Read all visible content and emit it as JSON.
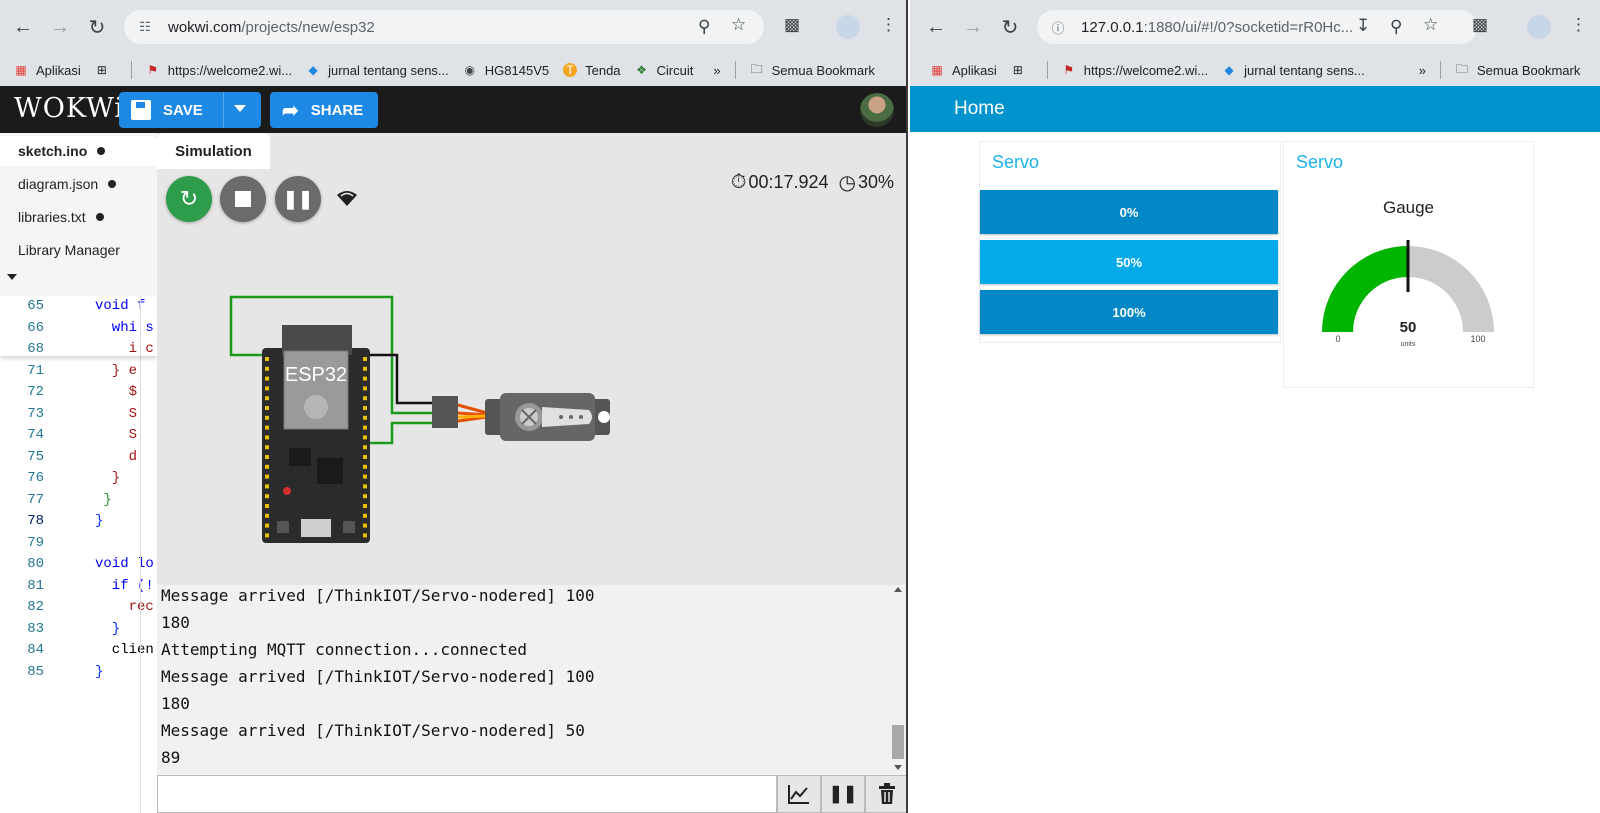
{
  "left_browser": {
    "omnibox": {
      "host": "wokwi.com",
      "path": "/projects/new/esp32"
    },
    "bookmarks": [
      {
        "label": "Aplikasi",
        "icon": "apps-grid-icon"
      },
      {
        "label": "https://welcome2.wi...",
        "icon": "bookmark-page-icon"
      },
      {
        "label": "jurnal tentang sens...",
        "icon": "diamond-icon"
      },
      {
        "label": "HG8145V5",
        "icon": "globe-icon"
      },
      {
        "label": "Tenda",
        "icon": "tenda-icon"
      },
      {
        "label": "Circuit",
        "icon": "circuit-icon"
      }
    ],
    "all_bookmarks": "Semua Bookmark",
    "more": "»"
  },
  "wokwi": {
    "logo": "WOKWi",
    "save_label": "SAVE",
    "share_label": "SHARE",
    "files": [
      {
        "name": "sketch.ino",
        "modified": true
      },
      {
        "name": "diagram.json",
        "modified": true
      },
      {
        "name": "libraries.txt",
        "modified": true
      },
      {
        "name": "Library Manager",
        "modified": false
      }
    ],
    "code_lines": [
      {
        "n": "65",
        "t": "void f"
      },
      {
        "n": "66",
        "t": "  whi s"
      },
      {
        "n": "68",
        "t": "    i c"
      },
      {
        "n": "71",
        "t": "  } e"
      },
      {
        "n": "72",
        "t": "    $"
      },
      {
        "n": "73",
        "t": "    S"
      },
      {
        "n": "74",
        "t": "    S"
      },
      {
        "n": "75",
        "t": "    d"
      },
      {
        "n": "76",
        "t": "  }"
      },
      {
        "n": "77",
        "t": " }"
      },
      {
        "n": "78",
        "t": "}"
      },
      {
        "n": "79",
        "t": ""
      },
      {
        "n": "80",
        "t": "void lo"
      },
      {
        "n": "81",
        "t": "  if (!"
      },
      {
        "n": "82",
        "t": "    rec"
      },
      {
        "n": "83",
        "t": "  }"
      },
      {
        "n": "84",
        "t": "  clien"
      },
      {
        "n": "85",
        "t": "}"
      }
    ],
    "simulation_tab": "Simulation",
    "timer": "00:17.924",
    "speed": "30%",
    "chip_label": "ESP32",
    "serial_lines": [
      "Message arrived [/ThinkIOT/Servo-nodered] 100",
      "180",
      "Attempting MQTT connection...connected",
      "Message arrived [/ThinkIOT/Servo-nodered] 100",
      "180",
      "Message arrived [/ThinkIOT/Servo-nodered] 50",
      "89"
    ]
  },
  "right_browser": {
    "omnibox": {
      "host": "127.0.0.1",
      "path": ":1880/ui/#!/0?socketid=rR0Hc..."
    },
    "bookmarks": [
      {
        "label": "Aplikasi",
        "icon": "apps-grid-icon"
      },
      {
        "label": "https://welcome2.wi...",
        "icon": "bookmark-page-icon"
      },
      {
        "label": "jurnal tentang sens...",
        "icon": "diamond-icon"
      }
    ],
    "all_bookmarks": "Semua Bookmark",
    "more": "»"
  },
  "dashboard": {
    "title": "Home",
    "group1_title": "Servo",
    "buttons": [
      {
        "label": "0%",
        "color": "#0288c7"
      },
      {
        "label": "50%",
        "color": "#03a9e8"
      },
      {
        "label": "100%",
        "color": "#0288c7"
      }
    ],
    "group2_title": "Servo",
    "gauge": {
      "title": "Gauge",
      "value": 50,
      "min": 0,
      "max": 100,
      "units": "units",
      "min_label": "0",
      "max_label": "100",
      "value_label": "50",
      "fill_color": "#00b500",
      "track_color": "#cccccc"
    }
  }
}
